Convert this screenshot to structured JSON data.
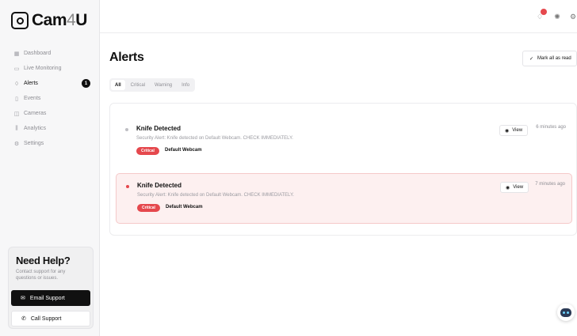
{
  "brand": {
    "name_main": "Cam",
    "name_digit": "4",
    "name_tail": "U"
  },
  "sidebar": {
    "items": [
      {
        "label": "Dashboard",
        "icon": "grid-icon"
      },
      {
        "label": "Live Monitoring",
        "icon": "video-icon"
      },
      {
        "label": "Alerts",
        "icon": "bell-icon",
        "badge": "1"
      },
      {
        "label": "Events",
        "icon": "file-icon"
      },
      {
        "label": "Cameras",
        "icon": "camera-icon"
      },
      {
        "label": "Analytics",
        "icon": "bar-chart-icon"
      },
      {
        "label": "Settings",
        "icon": "gear-icon"
      }
    ],
    "help": {
      "title": "Need Help?",
      "description": "Contact support for any questions or issues.",
      "email_label": "Email Support",
      "call_label": "Call Support"
    }
  },
  "main": {
    "title": "Alerts",
    "mark_all_label": "Mark all as read",
    "tabs": [
      "All",
      "Critical",
      "Warning",
      "Info"
    ],
    "alerts": [
      {
        "title": "Knife Detected",
        "message": "Security Alert: Knife detected on Default Webcam. CHECK IMMEDIATELY.",
        "severity": "Critical",
        "source": "Default Webcam",
        "view_label": "View",
        "time": "6 minutes ago"
      },
      {
        "title": "Knife Detected",
        "message": "Security Alert: Knife detected on Default Webcam. CHECK IMMEDIATELY.",
        "severity": "Critical",
        "source": "Default Webcam",
        "view_label": "View",
        "time": "7 minutes ago"
      }
    ]
  },
  "colors": {
    "critical": "#e5484d",
    "dark": "#111111",
    "unread_bg": "#fdf0f0"
  }
}
